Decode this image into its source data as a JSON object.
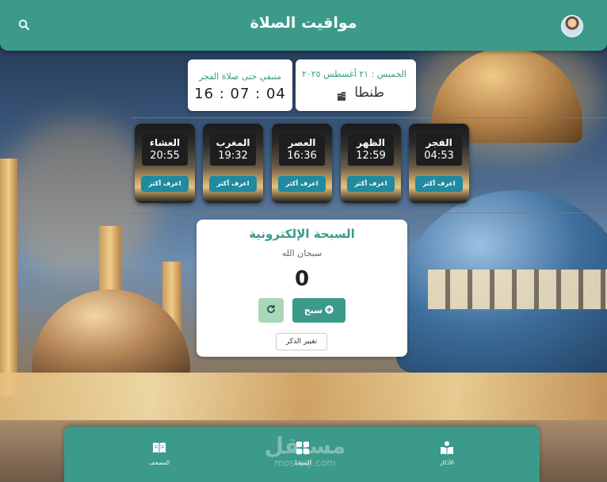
{
  "header": {
    "title": "مواقيت الصلاة",
    "search_icon": "search-icon",
    "avatar_icon": "user-avatar"
  },
  "date_card": {
    "date_label": "الخميس : ٢١ أغسطس ٢٠٢٥",
    "city": "طنطا",
    "city_icon": "building-icon"
  },
  "remaining_card": {
    "label": "متبقي حتى صلاة الفجر",
    "time": "16 : 07 : 04"
  },
  "prayers": [
    {
      "name": "الفجر",
      "time": "04:53",
      "button": "اعرف أكثر"
    },
    {
      "name": "الظهر",
      "time": "12:59",
      "button": "اعرف أكثر"
    },
    {
      "name": "العصر",
      "time": "16:36",
      "button": "اعرف أكثر"
    },
    {
      "name": "المغرب",
      "time": "19:32",
      "button": "اعرف أكثر"
    },
    {
      "name": "العشاء",
      "time": "20:55",
      "button": "اعرف أكثر"
    }
  ],
  "tasbih": {
    "title": "السبحة الإلكترونية",
    "dhikr": "سبحان الله",
    "count": "0",
    "count_button": "سبح",
    "reset_icon": "refresh-icon",
    "change_button": "تغيير الذكر"
  },
  "bottom_nav": {
    "mushaf": "المصحف",
    "sebha": "السبحة",
    "azkar": "الأذكار"
  },
  "watermark": {
    "main": "مستقل",
    "sub": "mostaql.com"
  },
  "colors": {
    "primary": "#3b9a8a",
    "tile_button": "#1f8aa0",
    "reset_button": "#a9d8b8"
  }
}
